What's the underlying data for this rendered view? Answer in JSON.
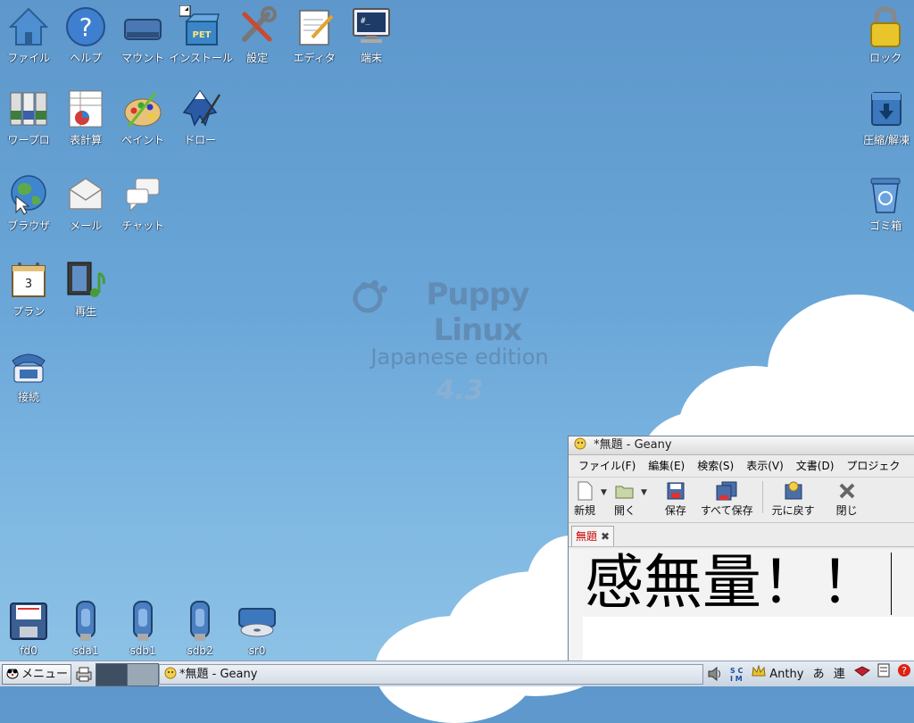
{
  "desktop": {
    "logo": {
      "line1": "Puppy Linux",
      "line2": "Japanese edition",
      "line3": "4.3"
    },
    "icons_left": [
      {
        "label": "ファイル"
      },
      {
        "label": "ヘルプ"
      },
      {
        "label": "マウント"
      },
      {
        "label": "インストール"
      },
      {
        "label": "設定"
      },
      {
        "label": "エディタ"
      },
      {
        "label": "端末"
      },
      {
        "label": "ワープロ"
      },
      {
        "label": "表計算"
      },
      {
        "label": "ペイント"
      },
      {
        "label": "ドロー"
      },
      {
        "label": "ブラウザ"
      },
      {
        "label": "メール"
      },
      {
        "label": "チャット"
      },
      {
        "label": "プラン"
      },
      {
        "label": "再生"
      },
      {
        "label": "接続"
      }
    ],
    "icons_right": [
      {
        "label": "ロック"
      },
      {
        "label": "圧縮/解凍"
      },
      {
        "label": "ゴミ箱"
      }
    ],
    "drives": [
      {
        "label": "fd0"
      },
      {
        "label": "sda1"
      },
      {
        "label": "sdb1"
      },
      {
        "label": "sdb2"
      },
      {
        "label": "sr0"
      }
    ],
    "install_badge": "PET",
    "calendar_day": "3",
    "terminal_prompt": "#_"
  },
  "geany": {
    "title": "*無題 - Geany",
    "menu": [
      "ファイル(F)",
      "編集(E)",
      "検索(S)",
      "表示(V)",
      "文書(D)",
      "プロジェク"
    ],
    "toolbar": {
      "new": "新規",
      "open": "開く",
      "save": "保存",
      "save_all": "すべて保存",
      "revert": "元に戻す",
      "close": "閉じ"
    },
    "tab": {
      "label": "無題"
    },
    "editor_text": "感無量！！"
  },
  "taskbar": {
    "menu_label": "メニュー",
    "task_label": "*無題 - Geany",
    "tray": {
      "scim": "SCIM",
      "anthy": "Anthy",
      "mode1": "あ",
      "mode2": "連"
    }
  },
  "colors": {
    "desktop_top": "#5d97cb",
    "desktop_bottom": "#8fc3e7",
    "tab_red": "#cc0000"
  }
}
